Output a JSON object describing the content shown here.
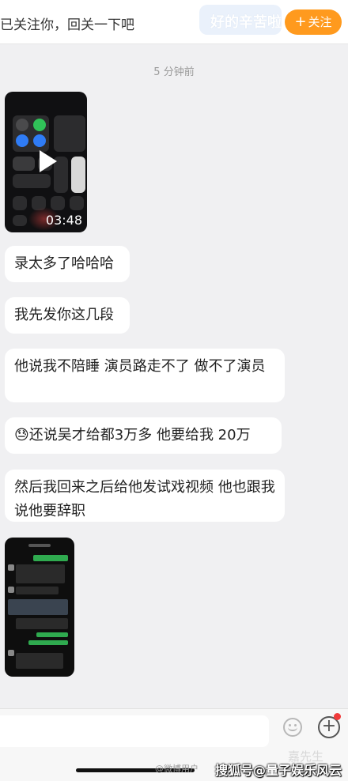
{
  "header": {
    "follow_hint": "已关注你，回关一下吧",
    "ghost_text": "好的辛苦啦",
    "follow_button": "关注",
    "follow_plus": "+"
  },
  "timestamp": "5 分钟前",
  "video": {
    "duration": "03:48"
  },
  "messages": [
    "录太多了哈哈哈",
    "我先发你这几段",
    "他说我不陪睡 演员路走不了 做不了演员",
    "还说吴才给都3万多 他要给我 20万",
    "然后我回来之后给他发试戏视频 他也跟我说他要辞职"
  ],
  "message_emoji": "😓",
  "watermark": {
    "weibo": "@微博用户",
    "main": "搜狐号@量子娱乐风云",
    "faint": "嘉先生"
  }
}
